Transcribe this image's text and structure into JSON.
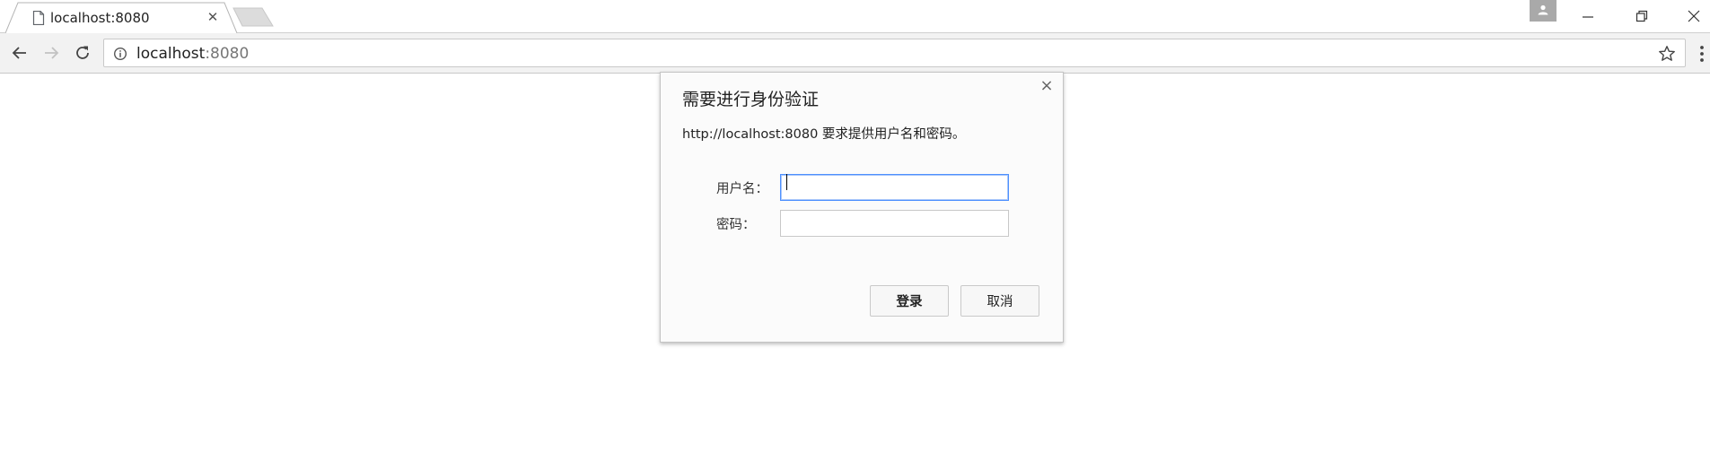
{
  "browser": {
    "tab": {
      "title": "localhost:8080",
      "favicon_icon": "page-icon",
      "close_glyph": "✕"
    },
    "address_bar": {
      "url_host": "localhost",
      "url_port": ":8080",
      "security_icon": "info-icon",
      "bookmark_icon": "star-icon"
    },
    "nav": {
      "back_icon": "arrow-left-icon",
      "forward_icon": "arrow-right-icon",
      "reload_icon": "reload-icon",
      "menu_icon": "kebab-menu-icon"
    },
    "window_controls": {
      "profile_icon": "person-icon",
      "minimize_icon": "minimize-icon",
      "restore_icon": "restore-icon",
      "close_icon": "close-icon"
    }
  },
  "dialog": {
    "title": "需要进行身份验证",
    "message": "http://localhost:8080 要求提供用户名和密码。",
    "close_glyph": "×",
    "username_label": "用户名：",
    "username_value": "",
    "password_label": "密码：",
    "password_value": "",
    "login_button": "登录",
    "cancel_button": "取消"
  },
  "colors": {
    "focus_border": "#4d90fe",
    "dialog_bg": "#fbfbfb",
    "toolbar_bg": "#f2f2f2",
    "profile_bg": "#a9a9a9"
  }
}
